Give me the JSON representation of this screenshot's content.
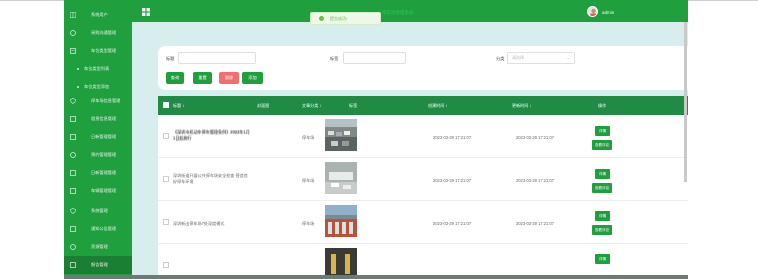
{
  "sidebar": {
    "items": [
      {
        "label": "系统用户",
        "icon": "grid-icon"
      },
      {
        "label": "采购沟通管理",
        "icon": "chat-icon"
      },
      {
        "label": "车位类型管理",
        "icon": "list-icon"
      },
      {
        "label": "车位类型列表",
        "sub": true
      },
      {
        "label": "车位类型添加",
        "sub": true
      },
      {
        "label": "停车场信息管理",
        "icon": "shield-icon"
      },
      {
        "label": "租赁信息管理",
        "icon": "list-icon"
      },
      {
        "label": "日新管理管理",
        "icon": "list-icon"
      },
      {
        "label": "预约管理管理",
        "icon": "chat-icon"
      },
      {
        "label": "日新管理管理",
        "icon": "list-icon"
      },
      {
        "label": "车辆管理管理",
        "icon": "list-icon"
      },
      {
        "label": "系统管理",
        "icon": "shield-icon"
      },
      {
        "label": "通知公告管理",
        "icon": "list-icon"
      },
      {
        "label": "资源管理",
        "icon": "chat-icon"
      },
      {
        "label": "报告管理",
        "icon": "list-icon"
      }
    ]
  },
  "header": {
    "title": "停车场管理系统",
    "username": "admin"
  },
  "toast": {
    "text": "提交成功!"
  },
  "search": {
    "title_label": "标题",
    "tag_label": "标签",
    "category_label": "分类",
    "category_placeholder": "请选择",
    "buttons": {
      "query": "查询",
      "reset": "重置",
      "delete": "删除",
      "add": "添加"
    }
  },
  "table": {
    "headers": [
      "标题 ↕",
      "封面图",
      "文章分类 ↕",
      "标签",
      "创建时间 ↕",
      "更新时间 ↕",
      "操作"
    ],
    "rows": [
      {
        "title": "《深圳市机动车停车管理条例》2023年1月1日起施行",
        "category": "停车场",
        "tag": "",
        "created": "2023-03-29 17:21:07",
        "updated": "2023-03-29 17:21:07",
        "op1": "详情",
        "op2": "查看评论"
      },
      {
        "title": "深圳街道开展公共停车场安全检查 营造良好停车环境",
        "category": "停车场",
        "tag": "",
        "created": "2023-03-29 17:21:07",
        "updated": "2023-03-29 17:21:07",
        "op1": "详情",
        "op2": "查看评论"
      },
      {
        "title": "深圳新出停车场7处深度模式",
        "category": "停车场",
        "tag": "",
        "created": "2023-03-29 17:21:07",
        "updated": "2023-03-29 17:21:07",
        "op1": "详情",
        "op2": "查看评论"
      },
      {
        "title": "",
        "category": "",
        "tag": "",
        "created": "",
        "updated": "",
        "op1": "详情",
        "op2": ""
      }
    ]
  },
  "colors": {
    "accent": "#1f9f3e",
    "header_dark": "#1f8b44",
    "danger": "#f56c6c"
  }
}
